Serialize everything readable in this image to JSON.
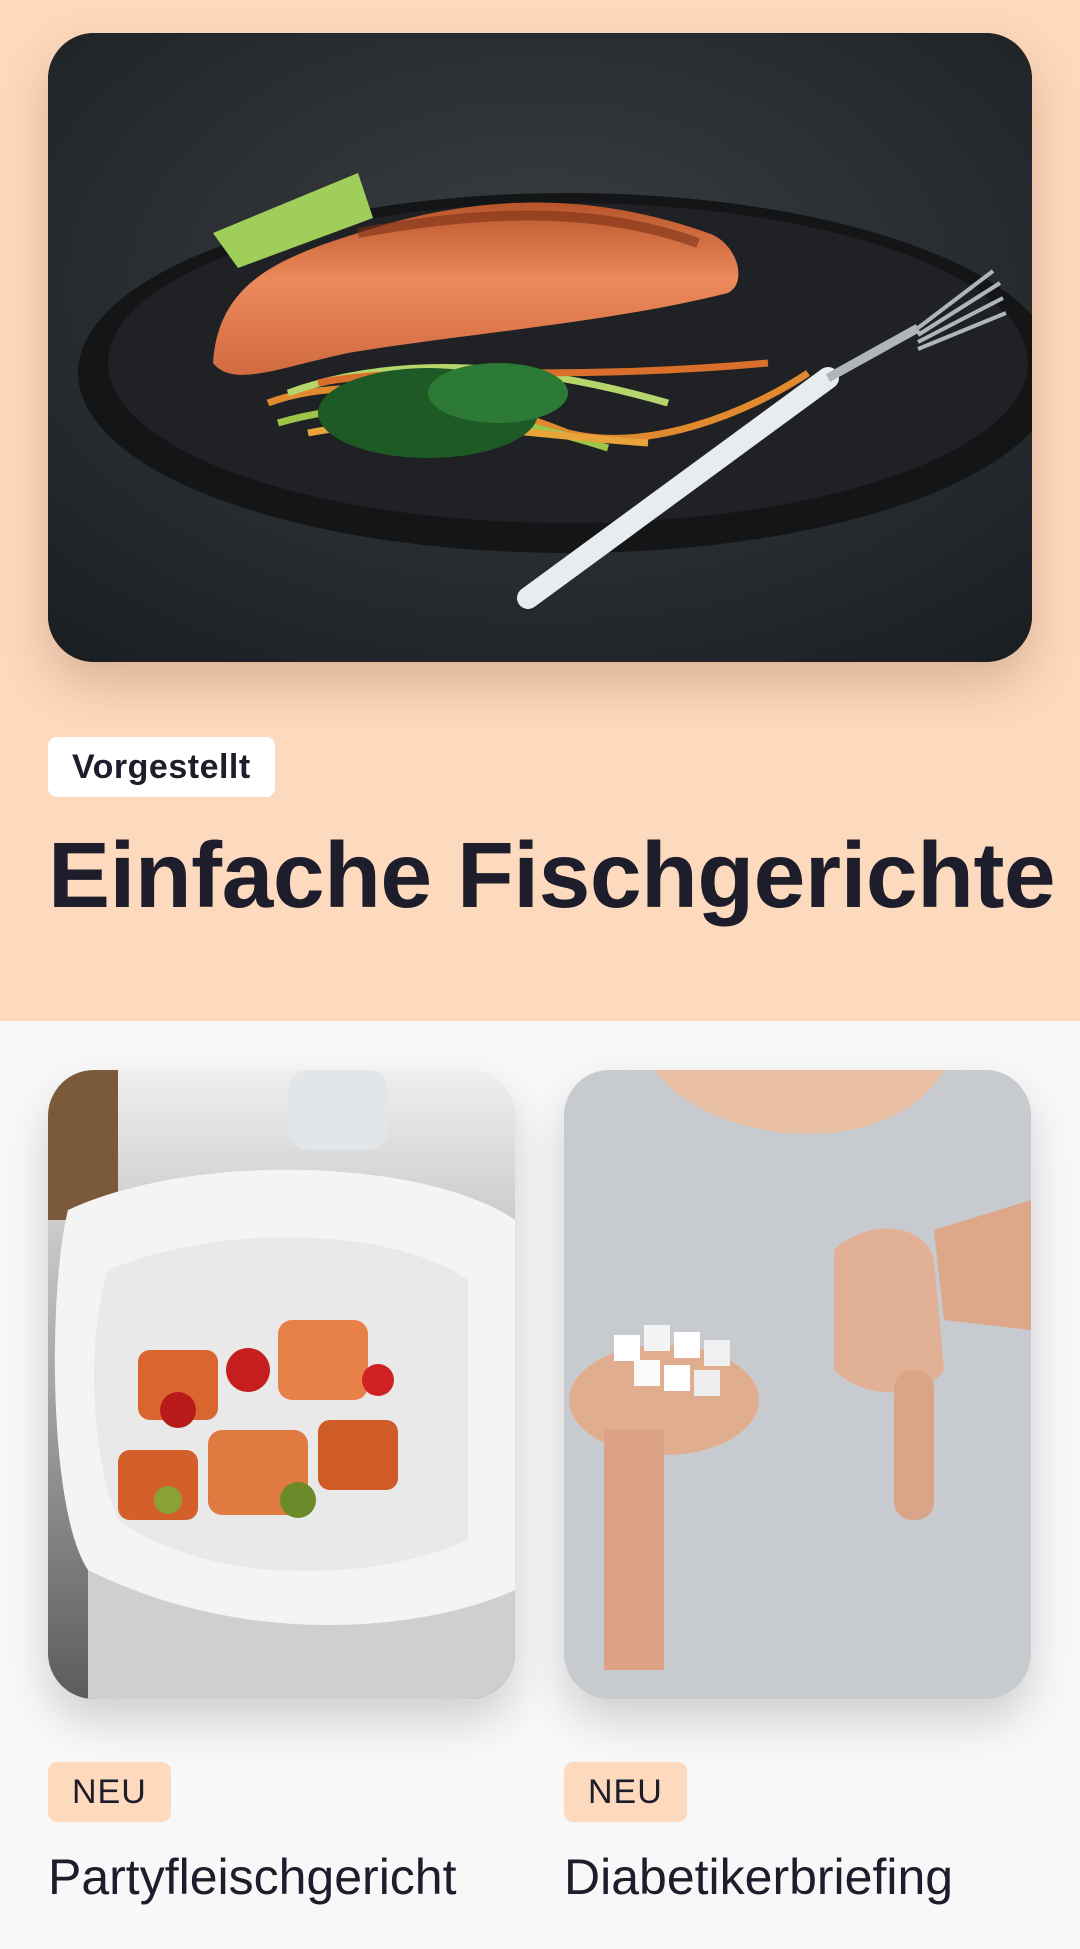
{
  "featured": {
    "badge": "Vorgestellt",
    "title": "Einfache Fischgerichte",
    "image_icon": "salmon-dish-photo"
  },
  "cards": [
    {
      "badge": "NEU",
      "title": "Partyfleischgericht",
      "image_icon": "meat-stew-photo"
    },
    {
      "badge": "NEU",
      "title": "Diabetikerbriefing",
      "image_icon": "sugar-cubes-thumbs-down-photo"
    }
  ],
  "colors": {
    "featured_bg": "#fdd9bd",
    "page_bg": "#f8f8f8",
    "text": "#1e1d2b",
    "badge_new_bg": "#fdd9bd"
  }
}
